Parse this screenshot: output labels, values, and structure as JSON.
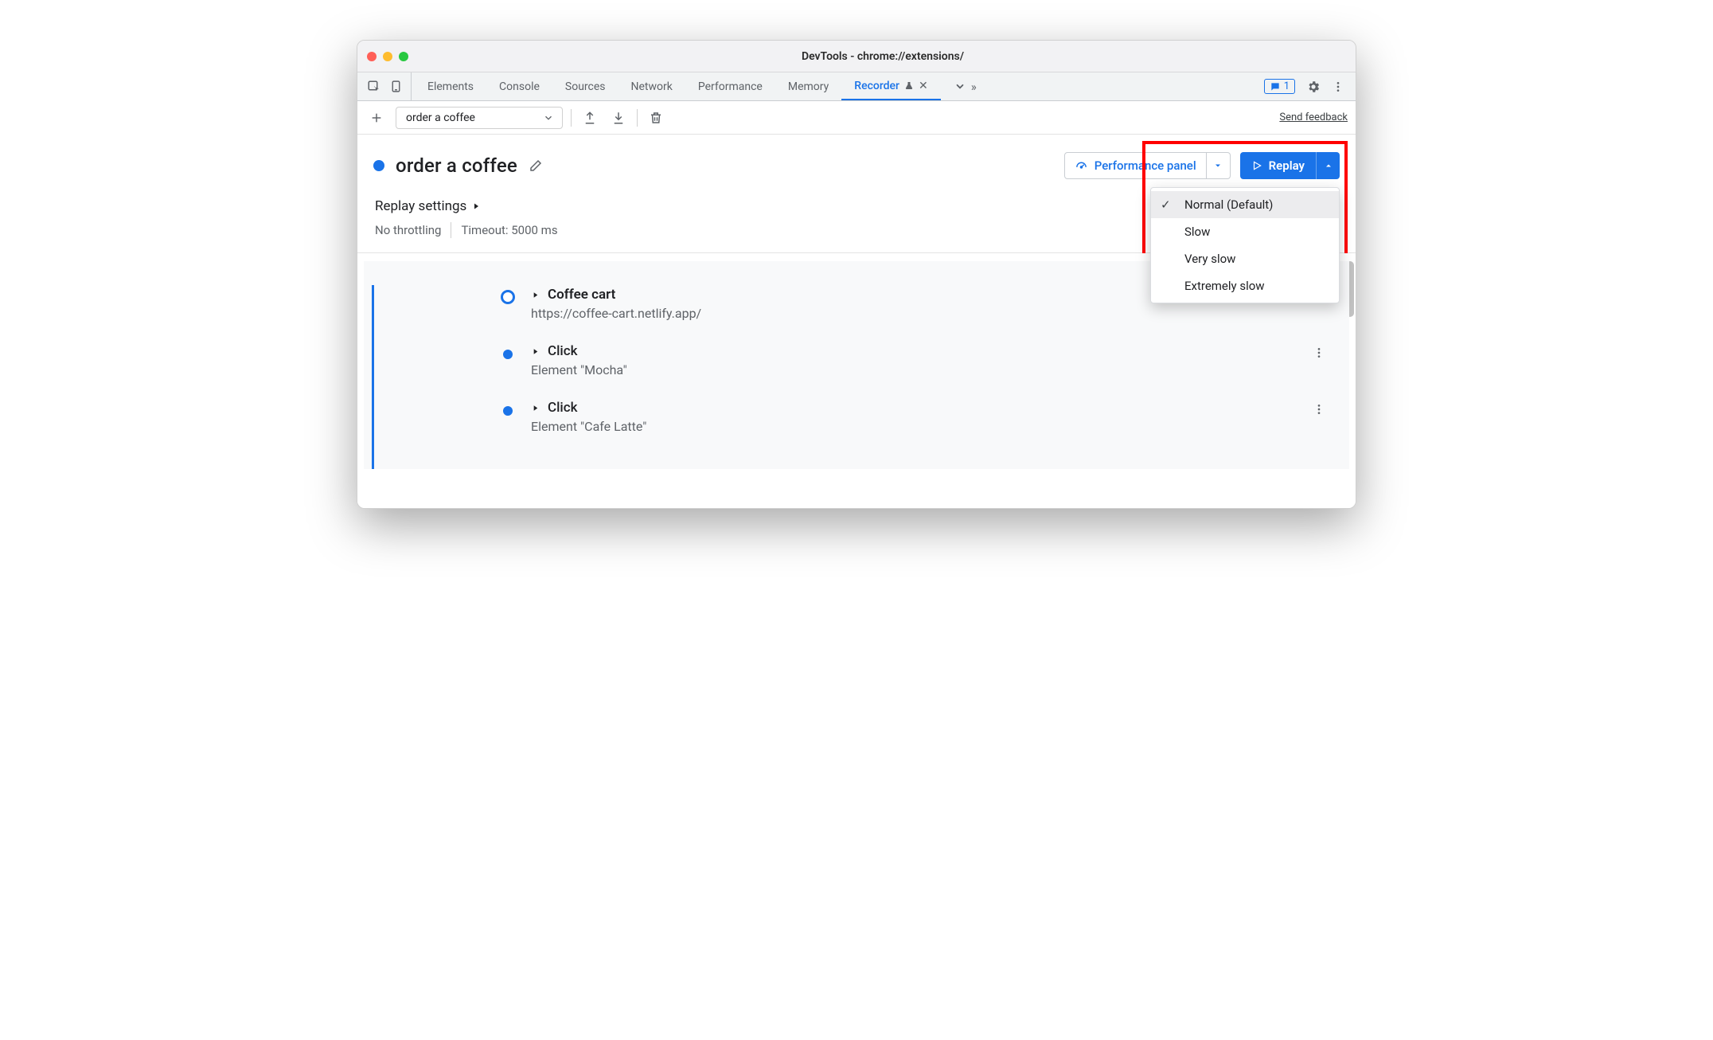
{
  "window": {
    "title": "DevTools - chrome://extensions/"
  },
  "tabs": {
    "elements": "Elements",
    "console": "Console",
    "sources": "Sources",
    "network": "Network",
    "performance": "Performance",
    "memory": "Memory",
    "recorder": "Recorder"
  },
  "issues_badge": "1",
  "subbar": {
    "recording_name": "order a coffee",
    "feedback": "Send feedback"
  },
  "header": {
    "title": "order a coffee",
    "performance_panel": "Performance panel",
    "replay": "Replay"
  },
  "replay_menu": {
    "options": [
      "Normal (Default)",
      "Slow",
      "Very slow",
      "Extremely slow"
    ],
    "selected_index": 0
  },
  "settings": {
    "title": "Replay settings",
    "throttling": "No throttling",
    "timeout": "Timeout: 5000 ms"
  },
  "steps": [
    {
      "title": "Coffee cart",
      "subtitle": "https://coffee-cart.netlify.app/",
      "bold": true,
      "open_node": true
    },
    {
      "title": "Click",
      "subtitle": "Element \"Mocha\"",
      "bold": false,
      "open_node": false
    },
    {
      "title": "Click",
      "subtitle": "Element \"Cafe Latte\"",
      "bold": false,
      "open_node": false
    }
  ]
}
